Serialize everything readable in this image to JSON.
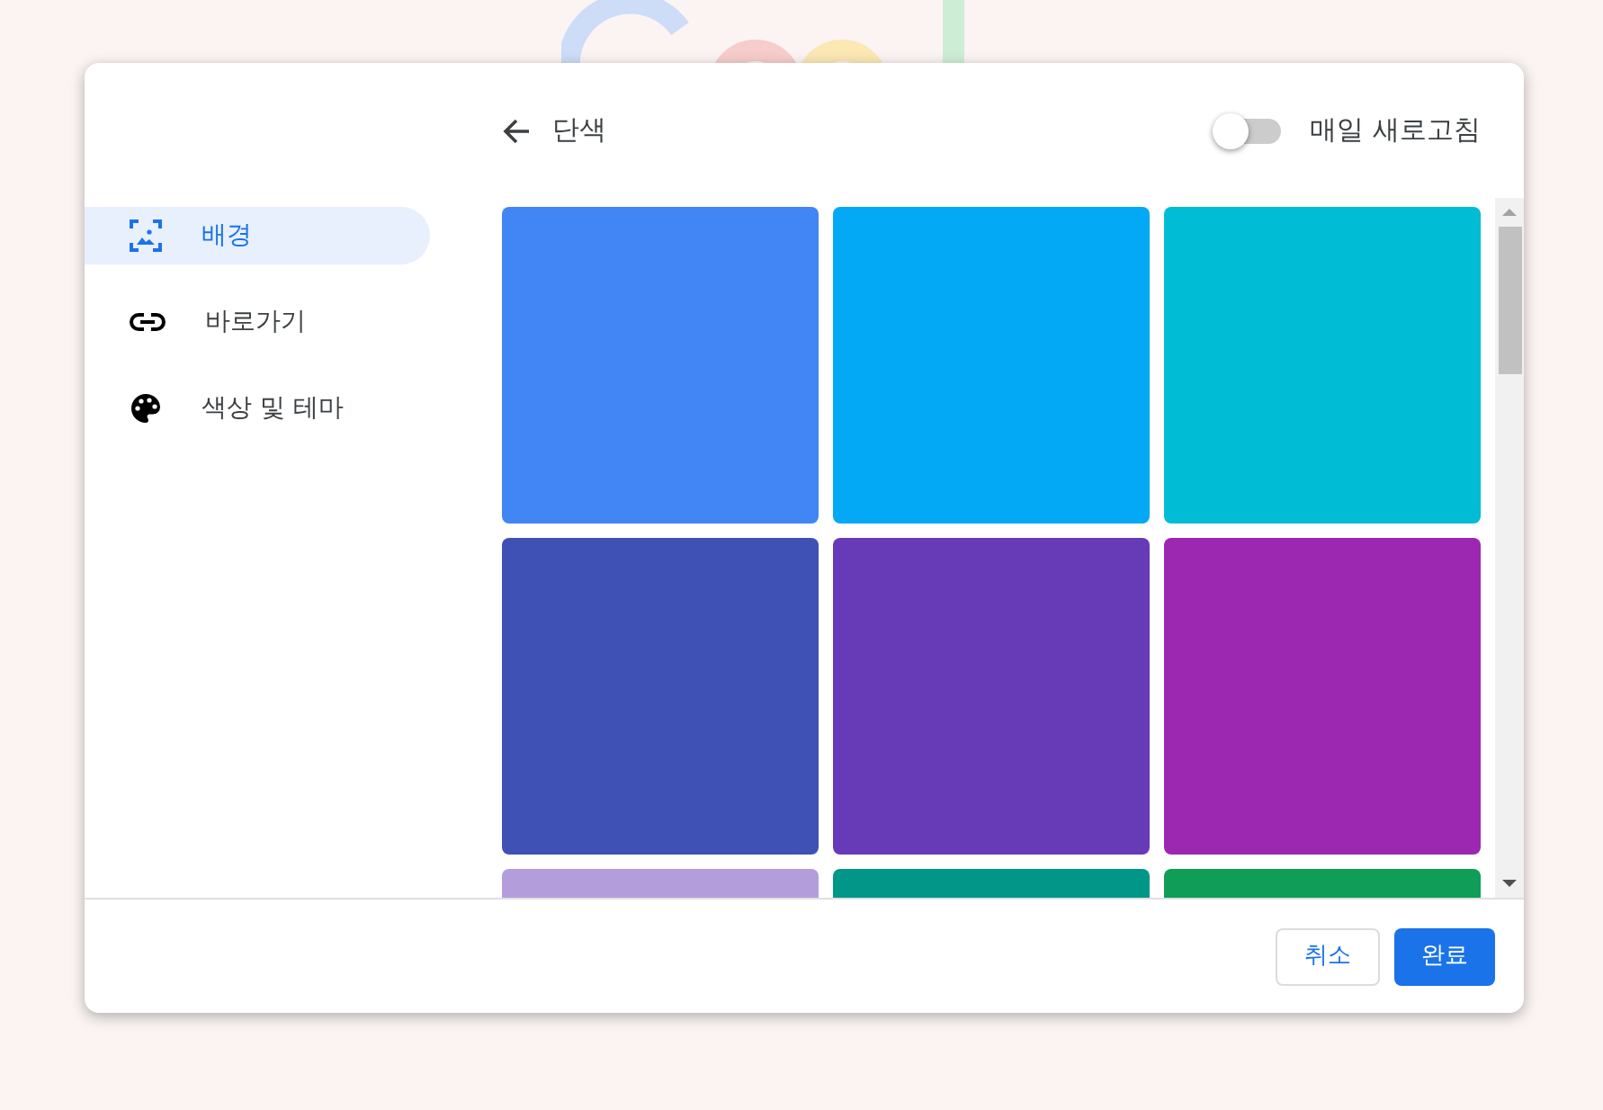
{
  "dialog": {
    "header": {
      "title": "단색",
      "toggle": {
        "label": "매일 새로고침",
        "on": false
      }
    },
    "sidebar": {
      "items": [
        {
          "label": "배경",
          "kind": "image",
          "selected": true
        },
        {
          "label": "바로가기",
          "kind": "link",
          "selected": false
        },
        {
          "label": "색상 및 테마",
          "kind": "palette",
          "selected": false
        }
      ]
    },
    "swatches": [
      {
        "color": "#4285f4"
      },
      {
        "color": "#03a9f4"
      },
      {
        "color": "#00bcd4"
      },
      {
        "color": "#3f51b5"
      },
      {
        "color": "#673ab7"
      },
      {
        "color": "#9c27b0"
      },
      {
        "color": "#b39ddb"
      },
      {
        "color": "#009688"
      },
      {
        "color": "#0f9d58"
      }
    ],
    "buttons": [
      {
        "label": "취소",
        "kind": "secondary"
      },
      {
        "label": "완료",
        "kind": "primary"
      }
    ]
  }
}
